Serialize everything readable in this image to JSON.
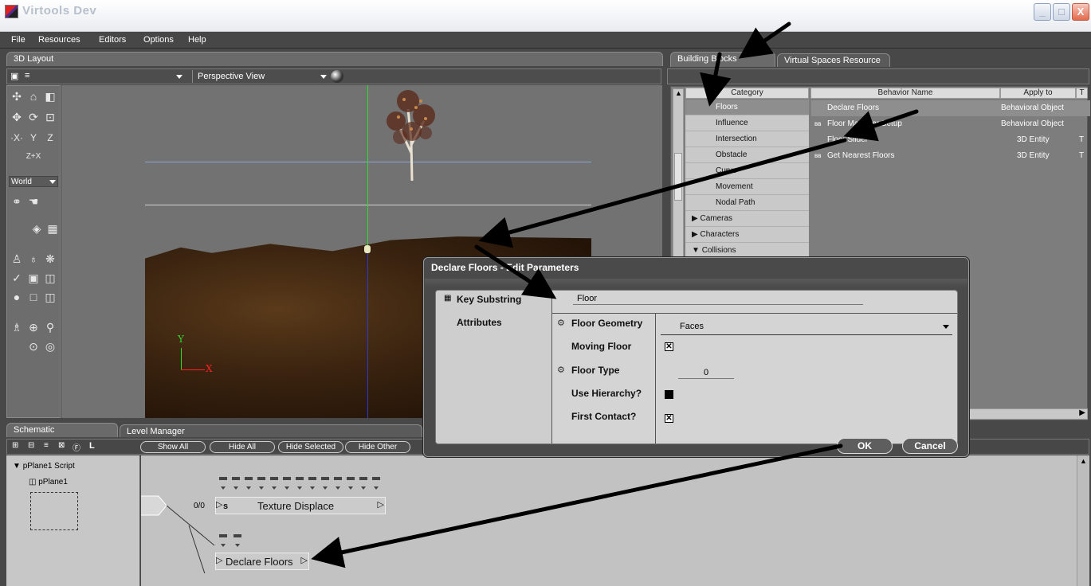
{
  "window": {
    "title": "Virtools Dev",
    "buttons": {
      "minimize": "_",
      "maximize": "□",
      "close": "X"
    }
  },
  "menu": {
    "file": "File",
    "resources": "Resources",
    "editors": "Editors",
    "options": "Options",
    "help": "Help"
  },
  "layout": {
    "tab": "3D Layout",
    "view": "Perspective View",
    "world": "World",
    "zx": "Z+X",
    "axis_y": "Y",
    "axis_x": "X"
  },
  "building_blocks": {
    "tabs": [
      "Building Blocks",
      "Virtual Spaces Resource"
    ],
    "headers": {
      "category": "Category",
      "behavior_name": "Behavior Name",
      "apply_to": "Apply to",
      "t": "T"
    },
    "categories": [
      "Floors",
      "Influence",
      "Intersection",
      "Obstacle",
      "Curve",
      "Movement",
      "Nodal Path",
      "Cameras",
      "Characters",
      "Collisions"
    ],
    "behaviors": [
      {
        "name": "Declare Floors",
        "apply": "Behavioral Object",
        "t": ""
      },
      {
        "name": "Floor Manager Setup",
        "apply": "Behavioral Object",
        "t": ""
      },
      {
        "name": "Floor Slider",
        "apply": "3D Entity",
        "t": "T"
      },
      {
        "name": "Get Nearest Floors",
        "apply": "3D Entity",
        "t": "T"
      }
    ]
  },
  "dialog": {
    "title": "Declare Floors - Edit Parameters",
    "key_substring_label": "Key Substring",
    "key_substring_value": "Floor",
    "attributes_label": "Attributes",
    "floor_geometry_label": "Floor Geometry",
    "floor_geometry_value": "Faces",
    "moving_floor_label": "Moving Floor",
    "floor_type_label": "Floor Type",
    "floor_type_value": "0",
    "use_hierarchy_label": "Use Hierarchy?",
    "first_contact_label": "First Contact?",
    "ok": "OK",
    "cancel": "Cancel"
  },
  "schematic": {
    "tabs": [
      "Schematic",
      "Level Manager"
    ],
    "buttons": {
      "l": "L",
      "show_all": "Show All",
      "hide_all": "Hide All",
      "hide_selected": "Hide Selected",
      "hide_other": "Hide Other"
    },
    "script_name": "pPlane1 Script",
    "object_name": "pPlane1",
    "link_label": "0/0",
    "node1": "Texture Displace",
    "node1_prefix": "s",
    "node2": "Declare Floors"
  }
}
